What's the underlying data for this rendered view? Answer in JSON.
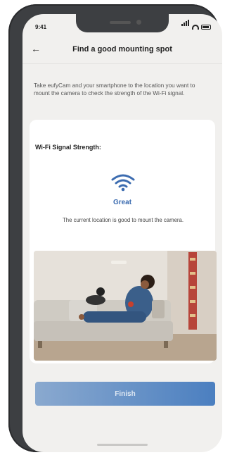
{
  "status_bar": {
    "time": "9:41"
  },
  "header": {
    "back_label": "←",
    "title": "Find a good mounting spot"
  },
  "intro_text": "Take eufyCam and your smartphone to the location you want to mount the camera to check the strength of the Wi-Fi signal.",
  "signal_card": {
    "title": "Wi-Fi Signal Strength:",
    "status": "Great",
    "description": "The current location is good to mount the camera."
  },
  "finish_button": {
    "label": "Finish"
  },
  "colors": {
    "accent": "#3c6cb0",
    "button_start": "#8aa9cf",
    "button_end": "#4b7fc0",
    "background": "#f1f0ee"
  },
  "icons": [
    "back-arrow-icon",
    "wifi-icon"
  ]
}
